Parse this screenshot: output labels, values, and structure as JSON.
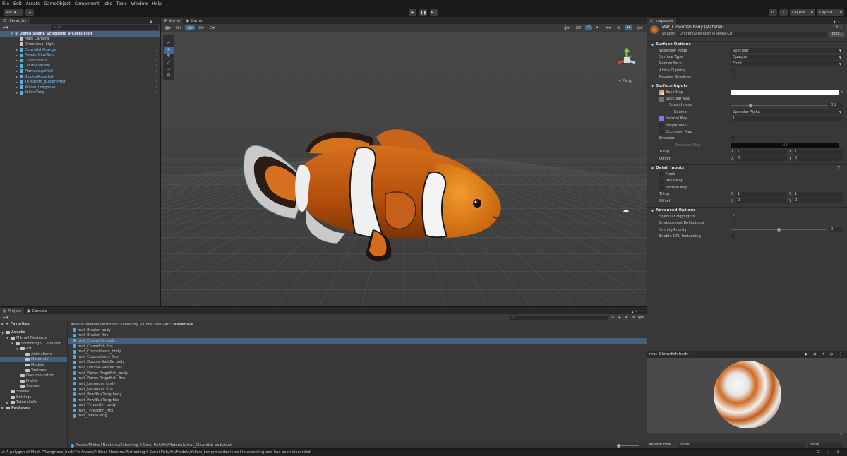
{
  "menu": [
    "File",
    "Edit",
    "Assets",
    "GameObject",
    "Component",
    "Jobs",
    "Tools",
    "Window",
    "Help"
  ],
  "toolbar": {
    "account": "MN",
    "layers": "Layers",
    "layout": "Layout"
  },
  "hierarchy": {
    "tab": "Hierarchy",
    "search_placeholder": "All",
    "scene": "Demo Scene Schooling 9 Coral Fish",
    "items": [
      {
        "label": "Main Camera",
        "type": "plain"
      },
      {
        "label": "Directional Light",
        "type": "plain"
      },
      {
        "label": "ClownfishOrange",
        "type": "prefab"
      },
      {
        "label": "PowderBlueTang",
        "type": "prefab"
      },
      {
        "label": "Copperband",
        "type": "prefab"
      },
      {
        "label": "DoubleSaddle",
        "type": "prefab"
      },
      {
        "label": "FlameAngelfish",
        "type": "prefab"
      },
      {
        "label": "BicolorAngelfish",
        "type": "prefab"
      },
      {
        "label": "Threadfin_Butterflyfish",
        "type": "prefab"
      },
      {
        "label": "Yellow_Longnose",
        "type": "prefab"
      },
      {
        "label": "YellowTang",
        "type": "prefab"
      }
    ]
  },
  "scene": {
    "tab_scene": "Scene",
    "tab_game": "Game",
    "mode_2d": "2D",
    "persp": "< Persp"
  },
  "inspector": {
    "tab": "Inspector",
    "material_name": "Mat_Clownfish body (Material)",
    "shader_label": "Shader",
    "shader_value": "Universal Render Pipeline/Lit",
    "edit_label": "Edit...",
    "surface_options": {
      "title": "Surface Options",
      "workflow_label": "Workflow Mode",
      "workflow_value": "Specular",
      "surface_type_label": "Surface Type",
      "surface_type_value": "Opaque",
      "render_face_label": "Render Face",
      "render_face_value": "Front",
      "alpha_clip_label": "Alpha Clipping",
      "receive_shadows_label": "Receive Shadows"
    },
    "surface_inputs": {
      "title": "Surface Inputs",
      "base_map": "Base Map",
      "specular_map": "Specular Map",
      "smoothness_label": "Smoothness",
      "smoothness_value": "0.2",
      "source_label": "Source",
      "source_value": "Specular Alpha",
      "normal_map": "Normal Map",
      "normal_value": "1",
      "height_map": "Height Map",
      "occlusion_map": "Occlusion Map",
      "emission_label": "Emission",
      "emission_map": "Emission Map",
      "emission_hdr": "HDR",
      "tiling_label": "Tiling",
      "tiling_x": "1",
      "tiling_y": "1",
      "offset_label": "Offset",
      "offset_x": "0",
      "offset_y": "0"
    },
    "detail_inputs": {
      "title": "Detail Inputs",
      "mask": "Mask",
      "base_map": "Base Map",
      "normal_map": "Normal Map",
      "tiling_label": "Tiling",
      "tiling_x": "1",
      "tiling_y": "1",
      "offset_label": "Offset",
      "offset_x": "0",
      "offset_y": "0"
    },
    "advanced": {
      "title": "Advanced Options",
      "specular_highlights": "Specular Highlights",
      "env_reflections": "Environment Reflections",
      "sorting_priority_label": "Sorting Priority",
      "sorting_priority_value": "0",
      "gpu_instancing": "Enable GPU Instancing"
    },
    "preview_title": "mat_Clownfish body",
    "assetbundle_label": "AssetBundle",
    "assetbundle_value": "None",
    "assetbundle_variant": "None"
  },
  "project": {
    "tab_project": "Project",
    "tab_console": "Console",
    "favorites": "Favorites",
    "tree": [
      {
        "label": "Assets",
        "depth": 0,
        "bold": true
      },
      {
        "label": "Mikhail Nesterov",
        "depth": 1
      },
      {
        "label": "Schooling 9 Coral Fish",
        "depth": 2
      },
      {
        "label": "Art",
        "depth": 3
      },
      {
        "label": "Animations",
        "depth": 4
      },
      {
        "label": "Materials",
        "depth": 4,
        "selected": true
      },
      {
        "label": "Models",
        "depth": 4
      },
      {
        "label": "Textures",
        "depth": 4
      },
      {
        "label": "Documentation",
        "depth": 3
      },
      {
        "label": "Prefab",
        "depth": 3
      },
      {
        "label": "Scenes",
        "depth": 3
      },
      {
        "label": "Scenes",
        "depth": 1
      },
      {
        "label": "Settings",
        "depth": 1
      },
      {
        "label": "TutorialInfo",
        "depth": 1
      },
      {
        "label": "Packages",
        "depth": 0,
        "bold": true
      }
    ],
    "breadcrumb": [
      "Assets",
      "Mikhail Nesterov",
      "Schooling 9 Coral Fish",
      "Art",
      "Materials"
    ],
    "files": [
      "mat_Bicolor_body",
      "mat_Bicolor_fins",
      "mat_Clownfish body",
      "mat_Clownfish fins",
      "mat_Copperband_body",
      "mat_Copperband_fins",
      "mat_Double-Saddle body",
      "mat_Double-Saddle fins",
      "mat_Flame Angelfish_body",
      "mat_Flame Angelfish_fins",
      "mat_Longnose body",
      "mat_Longnose fins",
      "mat_PowBlueTang body",
      "mat_PowBlueTang fins",
      "mat_Threadfin_body",
      "mat_Threadfin_fins",
      "mat_YellowTang"
    ],
    "selected_file": "mat_Clownfish body",
    "path": "Assets/Mikhail Nesterov/Schooling 9 Coral Fish/Art/Materials/mat_Clownfish body.mat",
    "count": "6"
  },
  "status": {
    "message": "A polygon of Mesh 'YLongnose_body' in Assets/Mikhail Nesterov/Schooling 9 Coral Fish/Art/Models/Yellow_Longnose.fbx is self-intersecting and has been discarded."
  },
  "colors": {
    "accent": "#4a8dda",
    "selection": "#2c5d87",
    "warning": "#f4c542"
  }
}
